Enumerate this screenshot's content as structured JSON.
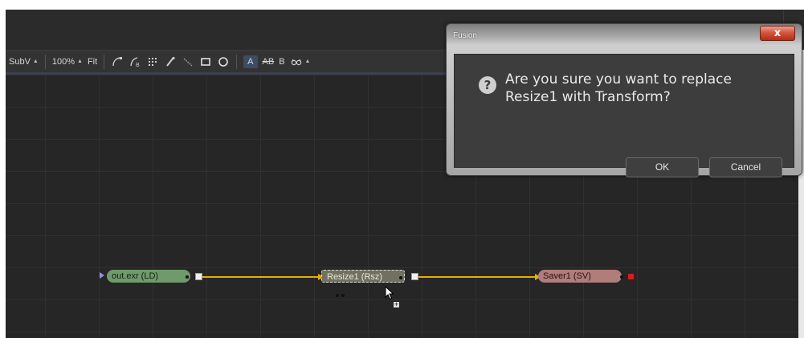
{
  "toolbar": {
    "subview_label": "SubV",
    "zoom_label": "100%",
    "fit_label": "Fit",
    "text_a": "A",
    "text_ab": "AB",
    "text_b": "B"
  },
  "nodes": {
    "loader": {
      "label": "out.exr  (LD)"
    },
    "resize": {
      "label": "Resize1  (Rsz)"
    },
    "saver": {
      "label": "Saver1  (SV)"
    }
  },
  "dialog": {
    "title": "Fusion",
    "close_glyph": "x",
    "icon_glyph": "?",
    "message": "Are you sure you want to replace Resize1 with Transform?",
    "ok_label": "OK",
    "cancel_label": "Cancel"
  },
  "colors": {
    "link": "#e6b000",
    "loader": "#6f9a6b",
    "resize": "#71715f",
    "saver": "#b07d7d",
    "close": "#c8432a"
  }
}
